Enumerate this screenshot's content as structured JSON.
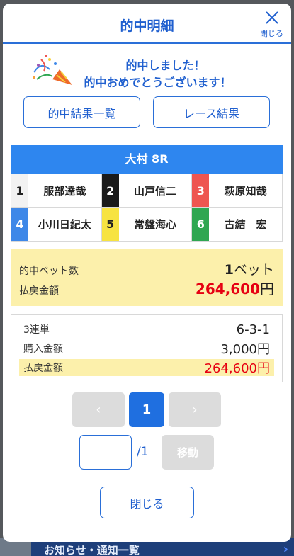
{
  "background": {
    "notice_label": "お知らせ・通知一覧"
  },
  "modal": {
    "title": "的中明細",
    "close_icon_label": "閉じる",
    "celebration": {
      "line1": "的中しました！",
      "line2": "的中おめでとうございます！"
    },
    "buttons": {
      "hit_results": "的中結果一覧",
      "race_results": "レース結果",
      "close": "閉じる",
      "move": "移動"
    },
    "race": {
      "title": "大村 8R",
      "racers": [
        {
          "num": "1",
          "name": "服部達哉",
          "bg": "#f2f2f2",
          "fg": "#222222"
        },
        {
          "num": "2",
          "name": "山戸信二",
          "bg": "#1a1a1a",
          "fg": "#ffffff"
        },
        {
          "num": "3",
          "name": "萩原知哉",
          "bg": "#ee5550",
          "fg": "#ffffff"
        },
        {
          "num": "4",
          "name": "小川日紀太",
          "bg": "#3e88e8",
          "fg": "#ffffff"
        },
        {
          "num": "5",
          "name": "常盤海心",
          "bg": "#f7e341",
          "fg": "#222222"
        },
        {
          "num": "6",
          "name": "古結　宏",
          "bg": "#2fa651",
          "fg": "#ffffff"
        }
      ]
    },
    "summary": {
      "bets_label": "的中ベット数",
      "bets_value": "1",
      "bets_unit": "ベット",
      "payout_label": "払戻金額",
      "payout_value": "264,600",
      "payout_unit": "円"
    },
    "detail": {
      "type": "3連単",
      "combination": "6-3-1",
      "purchase_label": "購入金額",
      "purchase_value": "3,000円",
      "payout_label": "払戻金額",
      "payout_value": "264,600円"
    },
    "pagination": {
      "prev": "‹",
      "current": "1",
      "next": "›",
      "input_value": "",
      "total": "/1"
    }
  }
}
